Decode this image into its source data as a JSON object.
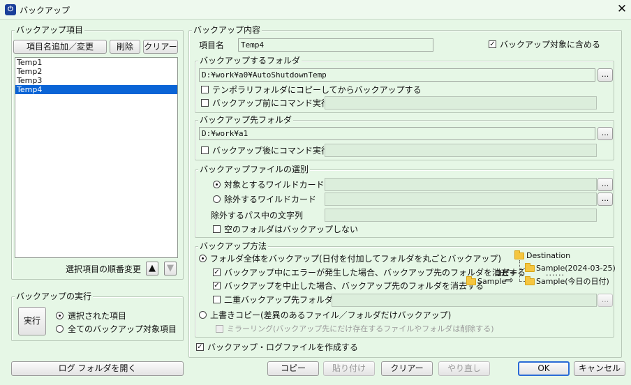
{
  "window": {
    "title": "バックアップ",
    "close": "✕"
  },
  "left": {
    "items_group": "バックアップ項目",
    "add_btn": "項目名追加／変更",
    "delete_btn": "削除",
    "clear_btn": "クリアー",
    "items": [
      "Temp1",
      "Temp2",
      "Temp3",
      "Temp4"
    ],
    "selected_index": 3,
    "reorder_label": "選択項目の順番変更",
    "up": "▲",
    "down": "▼",
    "exec_group": "バックアップの実行",
    "exec_btn": "実行",
    "radio_selected": "選択された項目",
    "radio_all": "全てのバックアップ対象項目",
    "log_btn": "ログ フォルダを開く"
  },
  "content": {
    "group": "バックアップ内容",
    "name_label": "項目名",
    "name_value": "Temp4",
    "include_label": "バックアップ対象に含める",
    "include_checked": true
  },
  "source": {
    "group": "バックアップするフォルダ",
    "path": "D:¥work¥a0¥AutoShutdownTemp",
    "browse": "...",
    "temp_copy": "テンポラリフォルダにコピーしてからバックアップする",
    "pre_cmd": "バックアップ前にコマンド実行",
    "pre_cmd_value": ""
  },
  "dest": {
    "group": "バックアップ先フォルダ",
    "path": "D:¥work¥a1",
    "browse": "...",
    "post_cmd": "バックアップ後にコマンド実行",
    "post_cmd_value": ""
  },
  "selection": {
    "group": "バックアップファイルの選別",
    "include_wild": "対象とするワイルドカード",
    "exclude_wild": "除外するワイルドカード",
    "exclude_path": "除外するパス中の文字列",
    "skip_empty": "空のフォルダはバックアップしない",
    "browse": "...",
    "selected": "include_wild"
  },
  "method": {
    "group": "バックアップ方法",
    "full": "フォルダ全体をバックアップ(日付を付加してフォルダを丸ごとバックアップ)",
    "err_delete": "バックアップ中にエラーが発生した場合、バックアップ先のフォルダを消去する",
    "cancel_delete": "バックアップを中止した場合、バックアップ先のフォルダを消去する",
    "double_dest": "二重バックアップ先フォルダ",
    "browse": "...",
    "overwrite": "上書きコピー(差異のあるファイル／フォルダだけバックアップ)",
    "mirror": "ミラーリング(バックアップ先にだけ存在するファイルやフォルダは削除する)",
    "diagram": {
      "destination": "Destination",
      "sample_dated": "Sample(2024-03-25)",
      "copy": "コピー",
      "sample": "Sample",
      "sample_today": "Sample(今日の日付)",
      "dots": "......"
    }
  },
  "log_file": "バックアップ・ログファイルを作成する",
  "bottom": {
    "copy": "コピー",
    "paste": "貼り付け",
    "clear": "クリアー",
    "redo": "やり直し",
    "ok": "OK",
    "cancel": "キャンセル"
  }
}
